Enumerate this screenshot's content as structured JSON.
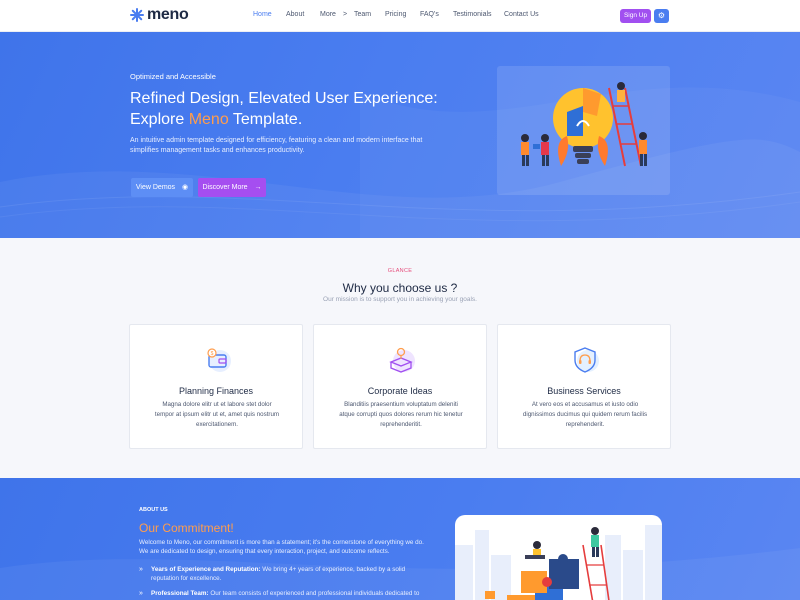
{
  "brand": {
    "name": "meno"
  },
  "nav": {
    "items": [
      "Home",
      "About",
      "More",
      "Team",
      "Pricing",
      "FAQ's",
      "Testimonials",
      "Contact Us"
    ],
    "more_arrow": ">",
    "active": "Home",
    "signup_label": "Sign Up",
    "settings_icon": "gear-icon"
  },
  "hero": {
    "eyebrow": "Optimized and Accessible",
    "title_line1": "Refined Design, Elevated User Experience:",
    "title_pre": "Explore ",
    "title_accent": "Meno",
    "title_post": " Template.",
    "description": "An intuitive admin template designed for efficiency, featuring a clean and modern interface that simplifies management tasks and enhances productivity.",
    "btn_demos": "View Demos",
    "btn_discover": "Discover More"
  },
  "features": {
    "eyebrow": "GLANCE",
    "title": "Why you choose us ?",
    "subtitle": "Our mission is to support you in achieving your goals.",
    "cards": [
      {
        "icon": "wallet-icon",
        "title": "Planning Finances",
        "text": "Magna dolore elitr ut et labore stet dolor tempor at ipsum elitr ut et, amet quis nostrum exercitationem."
      },
      {
        "icon": "idea-box-icon",
        "title": "Corporate Ideas",
        "text": "Blanditiis praesentium voluptatum deleniti atque corrupti quos dolores rerum hic tenetur reprehenderitit."
      },
      {
        "icon": "shield-headset-icon",
        "title": "Business Services",
        "text": "At vero eos et accusamus et iusto odio dignissimos ducimus qui quidem rerum facilis reprehenderit."
      }
    ]
  },
  "about": {
    "eyebrow": "ABOUT US",
    "title": "Our Commitment!",
    "description": "Welcome to Meno, our commitment is more than a statement; it's the cornerstone of everything we do. We are dedicated to design, ensuring that every interaction, project, and outcome reflects.",
    "points": [
      {
        "label": "Years of Experience and Reputation:",
        "text": " We bring 4+ years of experience, backed by a solid reputation for excellence."
      },
      {
        "label": "Professional Team:",
        "text": " Our team consists of experienced and professional individuals dedicated to"
      }
    ]
  },
  "colors": {
    "primary": "#4a7df0",
    "accent_orange": "#ff9d4d",
    "accent_purple": "#a14ff0",
    "glance_pink": "#e54b7a"
  }
}
